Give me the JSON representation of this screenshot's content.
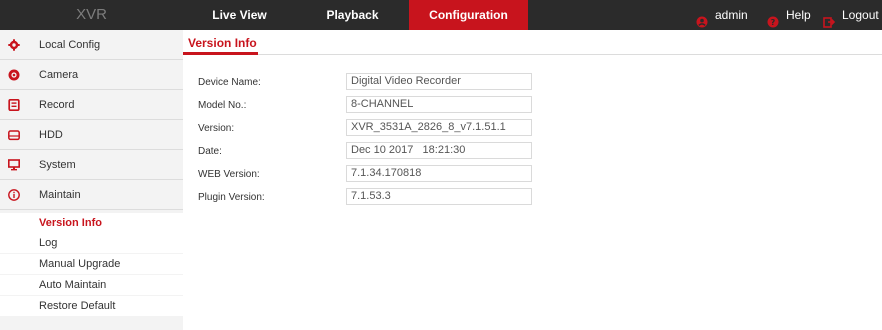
{
  "app": {
    "brand": "XVR"
  },
  "nav": {
    "live_view": "Live View",
    "playback": "Playback",
    "configuration": "Configuration"
  },
  "header_links": {
    "user": "admin",
    "help": "Help",
    "logout": "Logout"
  },
  "sidebar": {
    "items": [
      {
        "label": "Local Config",
        "icon": "gear-icon"
      },
      {
        "label": "Camera",
        "icon": "camera-icon"
      },
      {
        "label": "Record",
        "icon": "record-icon"
      },
      {
        "label": "HDD",
        "icon": "hdd-icon"
      },
      {
        "label": "System",
        "icon": "monitor-icon"
      },
      {
        "label": "Maintain",
        "icon": "info-icon"
      }
    ],
    "maintain_sub": [
      {
        "label": "Version Info",
        "active": true
      },
      {
        "label": "Log"
      },
      {
        "label": "Manual Upgrade"
      },
      {
        "label": "Auto Maintain"
      },
      {
        "label": "Restore Default"
      }
    ]
  },
  "main": {
    "tab": "Version Info",
    "fields": [
      {
        "label": "Device Name:",
        "value": "Digital Video Recorder"
      },
      {
        "label": "Model No.:",
        "value": "8-CHANNEL"
      },
      {
        "label": "Version:",
        "value": "XVR_3531A_2826_8_v7.1.51.1"
      },
      {
        "label": "Date:",
        "value": "Dec 10 2017   18:21:30"
      },
      {
        "label": "WEB Version:",
        "value": "7.1.34.170818"
      },
      {
        "label": "Plugin Version:",
        "value": "7.1.53.3"
      }
    ]
  },
  "colors": {
    "accent": "#c8141d",
    "topbar": "#2b2b2b",
    "sidebar": "#f3f3f3"
  }
}
